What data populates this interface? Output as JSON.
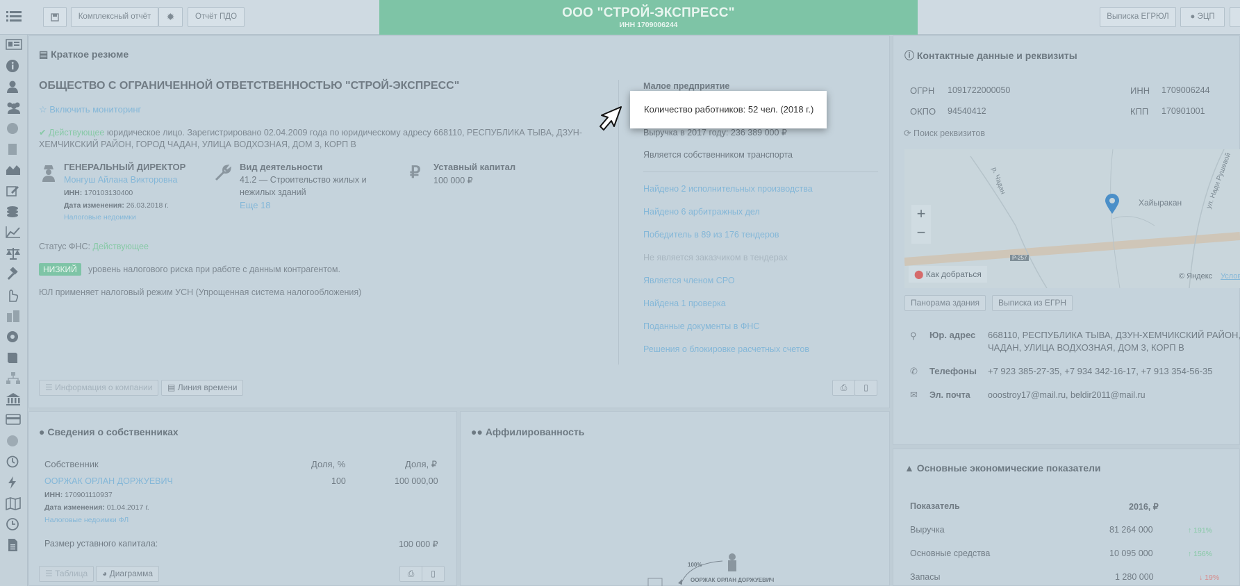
{
  "topbar": {
    "complex_report": "Комплексный отчёт",
    "pdo_report": "Отчёт ПДО",
    "company_short": "ООО \"СТРОЙ-ЭКСПРЕСС\"",
    "company_inn": "ИНН 1709006244",
    "egrul_extract": "Выписка ЕГРЮЛ",
    "ecp": "ЭЦП"
  },
  "summary": {
    "header": "Краткое резюме",
    "full_name": "ОБЩЕСТВО С ОГРАНИЧЕННОЙ ОТВЕТСТВЕННОСТЬЮ \"СТРОЙ-ЭКСПРЕСС\"",
    "monitoring": "☆ Включить мониторинг",
    "status_word": "Действующее",
    "reg_text_1": " юридическое лицо. Зарегистрировано 02.04.2009 года по юридическому адресу 668110, РЕСПУБЛИКА ТЫВА, ДЗУН-",
    "reg_text_2": "ХЕМЧИКСКИЙ РАЙОН, ГОРОД ЧАДАН, УЛИЦА ВОДХОЗНАЯ, ДОМ 3, КОРП В",
    "director_title": "ГЕНЕРАЛЬНЫЙ ДИРЕКТОР",
    "director_name": "Монгуш Айлана Викторовна",
    "director_inn_label": "ИНН:",
    "director_inn": " 170103130400",
    "change_date_label": "Дата изменения:",
    "change_date": " 26.03.2018 г.",
    "tax_arrears": "Налоговые недоимки",
    "activity_title": "Вид деятельности",
    "activity_line1": "41.2 — Строительство жилых и",
    "activity_line2": "нежилых зданий",
    "activity_more": "Еще 18",
    "capital_title": "Уставный капитал",
    "capital_value": "100 000 ₽",
    "fns_status_label": "Статус ФНС: ",
    "fns_status_value": "Действующее",
    "risk_badge": "НИЗКИЙ",
    "risk_text": "уровень налогового риска при работе с данным контрагентом.",
    "tax_regime": "ЮЛ применяет налоговый режим УСН (Упрощенная система налогообложения)",
    "small_business": "Малое предприятие",
    "employees": "Количество работников: 52 чел. (2018 г.)",
    "revenue": "Выручка в 2017 году: 236 389 000 ₽",
    "transport": "Является собственником транспорта",
    "links": [
      "Найдено 2 исполнительных производства",
      "Найдено 6 арбитражных дел",
      "Победитель в 89 из 176 тендеров",
      "Не является заказчиком в тендерах",
      "Является членом СРО",
      "Найдена 1 проверка",
      "Поданные документы в ФНС",
      "Решения о блокировке расчетных счетов"
    ],
    "btn_info": "Информация о компании",
    "btn_timeline": "Линия времени"
  },
  "contacts": {
    "header": "Контактные данные и реквизиты",
    "ogrn_label": "ОГРН",
    "ogrn": "1091722000050",
    "inn_label": "ИНН",
    "inn": "1709006244",
    "okpo_label": "ОКПО",
    "okpo": "94540412",
    "kpp_label": "КПП",
    "kpp": "170901001",
    "search_req": "Поиск реквизитов",
    "map_place": "Хайыракан",
    "map_road1": "р. Чадан",
    "map_road2": "ул. Нади Рушевой",
    "map_route": "Р-257",
    "map_directions": "Как добраться",
    "map_copyright": "© Яндекс",
    "map_terms": "Услов",
    "btn_panorama": "Панорама здания",
    "btn_egrn": "Выписка из ЕГРН",
    "addr_label": "Юр. адрес",
    "addr_1": "668110, РЕСПУБЛИКА ТЫВА, ДЗУН-ХЕМЧИКСКИЙ РАЙОН,",
    "addr_2": "ЧАДАН, УЛИЦА ВОДХОЗНАЯ, ДОМ 3, КОРП В",
    "phone_label": "Телефоны",
    "phones": "+7 923 385-27-35, +7 934 342-16-17, +7 913 354-56-35",
    "email_label": "Эл. почта",
    "emails": "ooostroy17@mail.ru, beldir2011@mail.ru"
  },
  "owners": {
    "header": "Сведения о собственниках",
    "col_owner": "Собственник",
    "col_share_pct": "Доля, %",
    "col_share_rub": "Доля, ₽",
    "owner_name": "ООРЖАК ОРЛАН ДОРЖУЕВИЧ",
    "owner_pct": "100",
    "owner_rub": "100 000,00",
    "owner_inn_label": "ИНН:",
    "owner_inn": " 170901110937",
    "owner_date_label": "Дата изменения:",
    "owner_date": " 01.04.2017 г.",
    "owner_tax": "Налоговые недоимки ФЛ",
    "capital_label": "Размер уставного капитала:",
    "capital_value": "100 000 ₽",
    "btn_table": "Таблица",
    "btn_diagram": "Диаграмма"
  },
  "affiliation": {
    "header": "Аффилированность",
    "share": "100%",
    "person": "ООРЖАК ОРЛАН ДОРЖУЕВИЧ"
  },
  "economics": {
    "header": "Основные экономические показатели",
    "col_indicator": "Показатель",
    "col_year": "2016, ₽",
    "rows": [
      {
        "name": "Выручка",
        "value": "81 264 000",
        "change": "↑ 191%"
      },
      {
        "name": "Основные средства",
        "value": "10 095 000",
        "change": "↑ 156%"
      },
      {
        "name": "Запасы",
        "value": "1 280 000",
        "change": "↓ 19%"
      }
    ]
  },
  "colors": {
    "accent_green": "#7ec4a6",
    "link": "#84b7d8",
    "overlay": "#bfcdd6"
  }
}
